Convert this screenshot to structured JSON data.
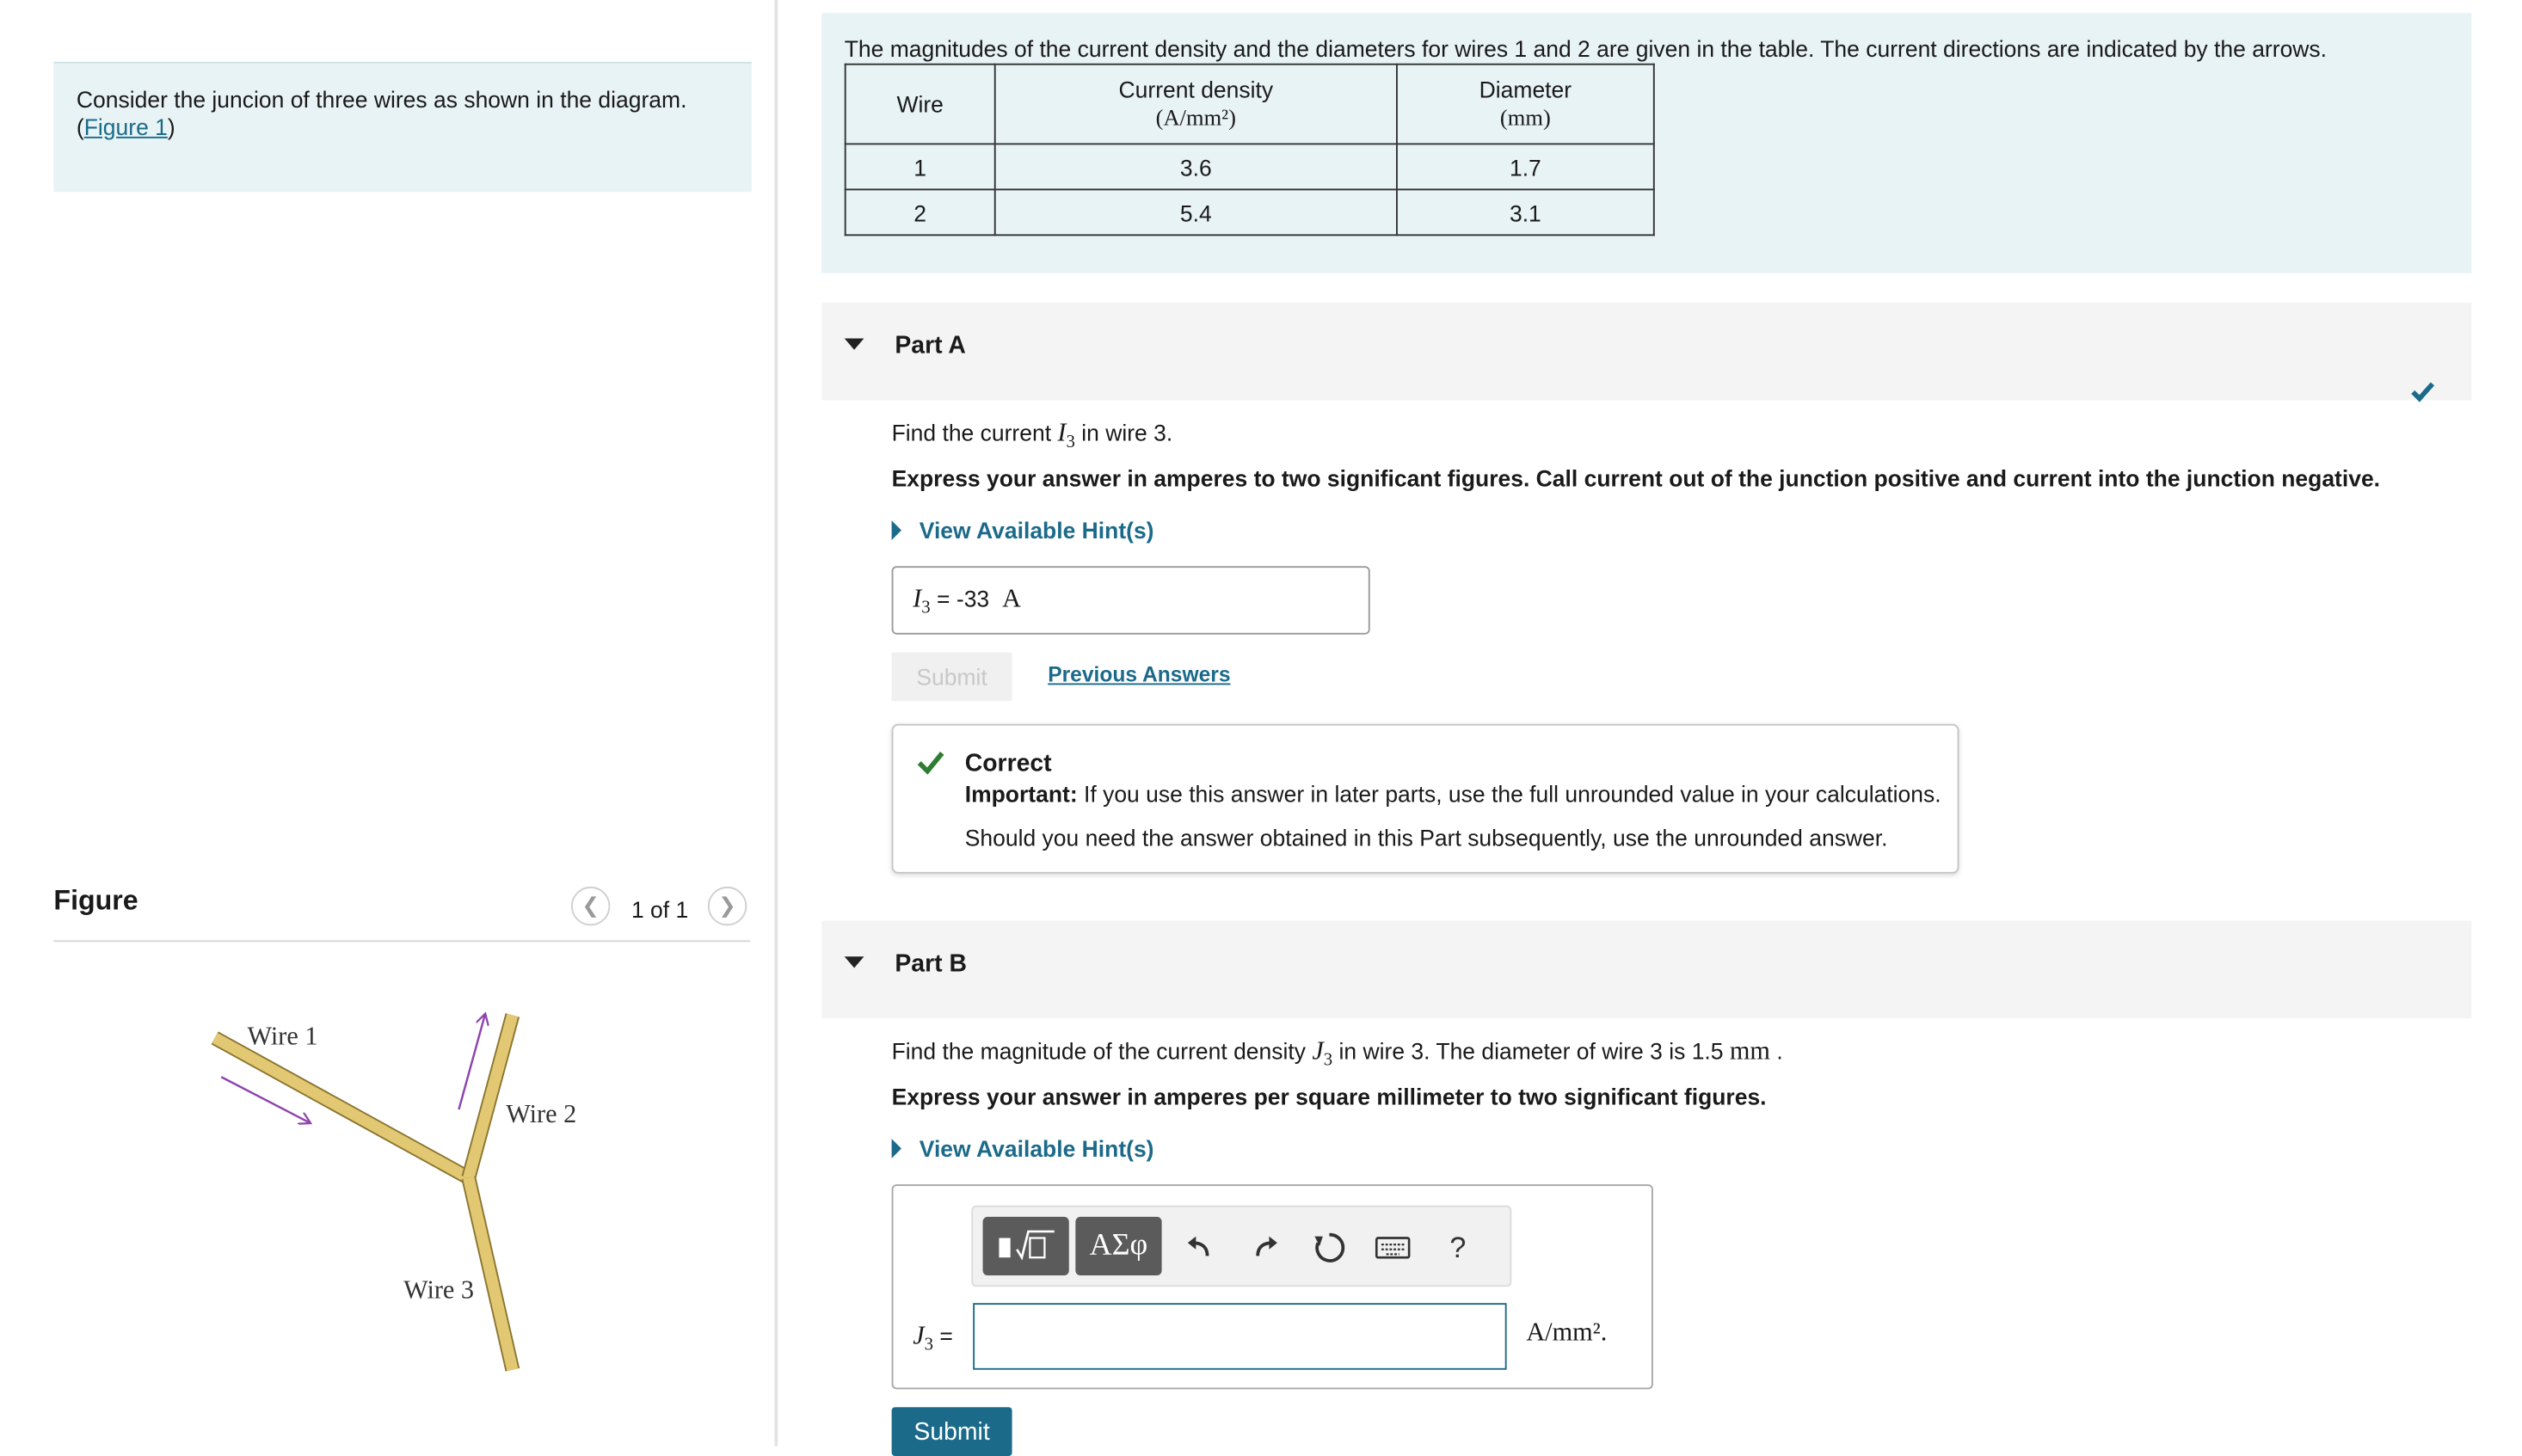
{
  "intro": {
    "text": "Consider the juncion of three wires as shown in the diagram. (",
    "link": "Figure 1",
    "after": ")"
  },
  "figure": {
    "title": "Figure",
    "counter": "1 of 1",
    "wire1_label": "Wire 1",
    "wire2_label": "Wire 2",
    "wire3_label": "Wire 3",
    "wire_color": "#e3c874",
    "arrow_color": "#8e44ad"
  },
  "problem": {
    "lead": "The magnitudes of the current density and the diameters for wires 1 and 2 are given in the table. The current directions are indicated by the arrows.",
    "table": {
      "headers": {
        "wire": "Wire",
        "density": "Current density",
        "density_unit": "(A/mm²)",
        "diameter": "Diameter",
        "diameter_unit": "(mm)"
      },
      "rows": [
        {
          "wire": "1",
          "density": "3.6",
          "diameter": "1.7"
        },
        {
          "wire": "2",
          "density": "5.4",
          "diameter": "3.1"
        }
      ]
    }
  },
  "partA": {
    "label": "Part A",
    "question_pre": "Find the current ",
    "question_var": "I",
    "question_sub": "3",
    "question_post": " in wire 3.",
    "instruction": "Express your answer in amperes to two significant figures. Call current out of the junction positive and current into the junction negative.",
    "hint": "View Available Hint(s)",
    "answer_var": "I",
    "answer_sub": "3",
    "answer_eq": " = ",
    "answer_value": "-33",
    "answer_unit": "A",
    "submit": "Submit",
    "previous": "Previous Answers",
    "feedback_title": "Correct",
    "feedback_important": "Important:",
    "feedback_important_text": " If you use this answer in later parts, use the full unrounded value in your calculations.",
    "feedback_note": "Should you need the answer obtained in this Part subsequently, use the unrounded answer."
  },
  "partB": {
    "label": "Part B",
    "question_pre": "Find the magnitude of the current density ",
    "question_var": "J",
    "question_sub": "3",
    "question_post": " in wire 3. The diameter of wire 3 is 1.5 ",
    "question_unit": "mm",
    "question_end": " .",
    "instruction": "Express your answer in amperes per square millimeter to two significant figures.",
    "hint": "View Available Hint(s)",
    "input_var": "J",
    "input_sub": "3",
    "input_eq": " =",
    "input_value": "",
    "unit": "A/mm²",
    "unit_end": ".",
    "toolbar": {
      "greek": "ΑΣφ",
      "help": "?"
    },
    "submit": "Submit"
  },
  "colors": {
    "accent": "#1b6a8a",
    "panel": "#e8f3f5",
    "check": "#2e7d32",
    "check_part": "#1b6a8a"
  }
}
